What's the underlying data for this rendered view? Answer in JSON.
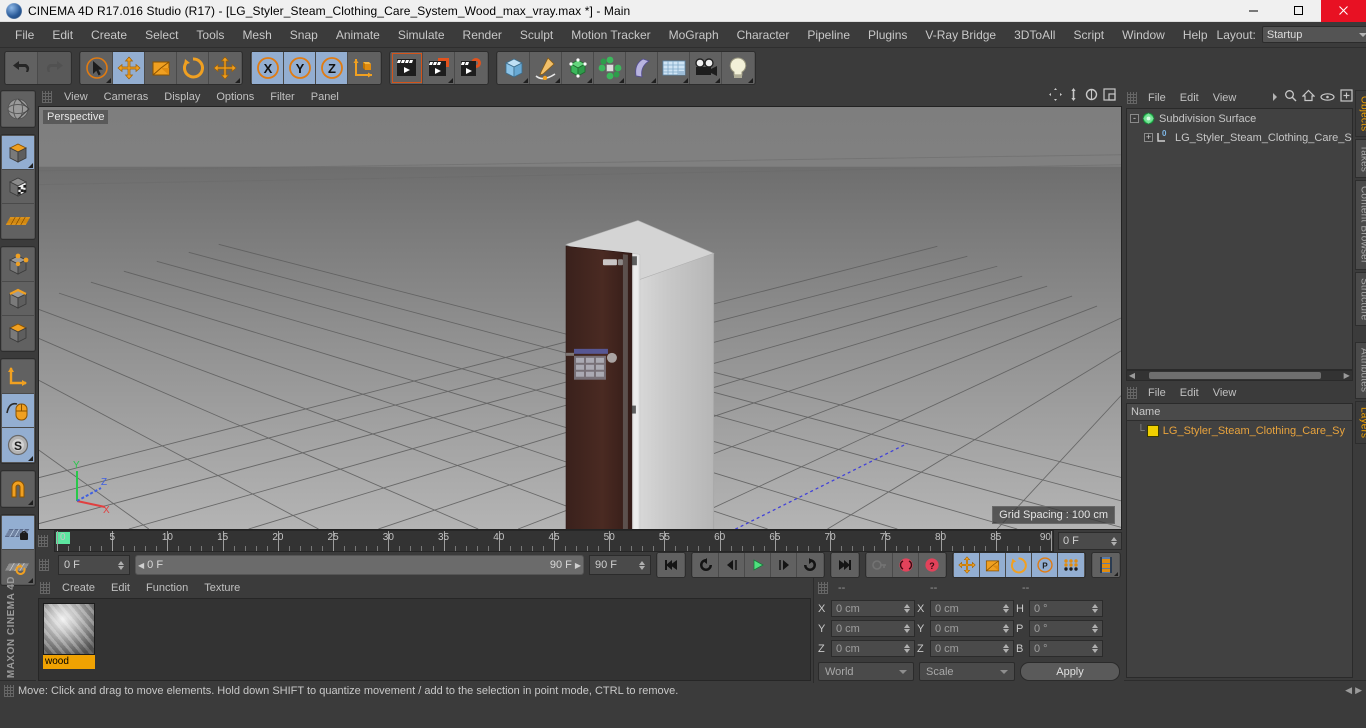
{
  "titlebar": {
    "title": "CINEMA 4D R17.016 Studio (R17) - [LG_Styler_Steam_Clothing_Care_System_Wood_max_vray.max *] - Main",
    "minimize": "minimize-icon",
    "maximize": "maximize-icon",
    "close": "close-icon"
  },
  "menubar": {
    "items": [
      "File",
      "Edit",
      "Create",
      "Select",
      "Tools",
      "Mesh",
      "Snap",
      "Animate",
      "Simulate",
      "Render",
      "Sculpt",
      "Motion Tracker",
      "MoGraph",
      "Character",
      "Pipeline",
      "Plugins",
      "V-Ray Bridge",
      "3DToAll",
      "Script",
      "Window",
      "Help"
    ],
    "layout_label": "Layout:",
    "layout_value": "Startup",
    "search_icon": "search-icon"
  },
  "toolbar": {
    "groups": [
      {
        "name": "history",
        "buttons": [
          {
            "name": "undo-button",
            "icon": "undo-arrow-icon",
            "state": "normal"
          },
          {
            "name": "redo-button",
            "icon": "redo-arrow-icon",
            "state": "disabled"
          }
        ]
      },
      {
        "name": "transform-tools",
        "buttons": [
          {
            "name": "live-selection-tool",
            "icon": "cursor-circle-icon",
            "state": "corner"
          },
          {
            "name": "move-tool",
            "icon": "move-arrows-icon",
            "state": "active"
          },
          {
            "name": "scale-tool",
            "icon": "scale-box-icon",
            "state": "normal"
          },
          {
            "name": "rotate-tool",
            "icon": "rotate-circle-icon",
            "state": "normal"
          },
          {
            "name": "move-duplicate-tool",
            "icon": "move-arrows-icon",
            "state": "corner"
          }
        ]
      },
      {
        "name": "axis-locks",
        "buttons": [
          {
            "name": "lock-x-axis",
            "icon": "x-axis-icon",
            "state": "active"
          },
          {
            "name": "lock-y-axis",
            "icon": "y-axis-icon",
            "state": "active"
          },
          {
            "name": "lock-z-axis",
            "icon": "z-axis-icon",
            "state": "active"
          },
          {
            "name": "world-object-axis",
            "icon": "axis-cube-icon",
            "state": "normal"
          }
        ]
      },
      {
        "name": "render-group",
        "buttons": [
          {
            "name": "render-view-button",
            "icon": "clapper-icon",
            "state": "highlight"
          },
          {
            "name": "render-to-picture-viewer",
            "icon": "clapper-render-icon",
            "state": "corner"
          },
          {
            "name": "render-settings-button",
            "icon": "clapper-gear-icon",
            "state": "normal"
          }
        ]
      },
      {
        "name": "create-group",
        "buttons": [
          {
            "name": "add-cube-button",
            "icon": "cube-icon",
            "state": "corner"
          },
          {
            "name": "add-spline-button",
            "icon": "pen-spline-icon",
            "state": "corner"
          },
          {
            "name": "add-nurbs-button",
            "icon": "green-cube-icon",
            "state": "corner"
          },
          {
            "name": "add-array-button",
            "icon": "green-array-icon",
            "state": "corner"
          },
          {
            "name": "add-bend-button",
            "icon": "bend-deformer-icon",
            "state": "corner"
          },
          {
            "name": "add-floor-button",
            "icon": "floor-grid-icon",
            "state": "corner"
          },
          {
            "name": "add-camera-button",
            "icon": "camera-icon",
            "state": "corner"
          },
          {
            "name": "add-light-button",
            "icon": "light-bulb-icon",
            "state": "corner"
          }
        ]
      }
    ]
  },
  "lefttoolbar": {
    "groups": [
      {
        "buttons": [
          {
            "name": "make-editable-button",
            "icon": "globe-editable-icon",
            "state": "normal"
          }
        ]
      },
      {
        "buttons": [
          {
            "name": "model-mode-button",
            "icon": "model-cube-icon",
            "state": "active"
          },
          {
            "name": "texture-mode-button",
            "icon": "texture-checker-cube-icon",
            "state": "normal"
          },
          {
            "name": "uv-mode-button",
            "icon": "uv-mesh-icon",
            "state": "normal"
          }
        ]
      },
      {
        "buttons": [
          {
            "name": "points-mode-button",
            "icon": "points-cube-icon",
            "state": "normal"
          },
          {
            "name": "edges-mode-button",
            "icon": "edges-cube-icon",
            "state": "normal"
          },
          {
            "name": "polygons-mode-button",
            "icon": "polygons-cube-icon",
            "state": "normal"
          }
        ]
      },
      {
        "buttons": [
          {
            "name": "object-axis-mode-button",
            "icon": "axis-corner-icon",
            "state": "normal"
          },
          {
            "name": "viewport-solo-button",
            "icon": "mouse-curve-icon",
            "state": "active"
          },
          {
            "name": "soft-selection-button",
            "icon": "s-circle-icon",
            "state": "active"
          }
        ]
      },
      {
        "buttons": [
          {
            "name": "snap-button",
            "icon": "magnet-icon",
            "state": "corner"
          }
        ]
      },
      {
        "buttons": [
          {
            "name": "workplane-lock-button",
            "icon": "grid-lock-icon",
            "state": "active"
          },
          {
            "name": "workplane-rotate-button",
            "icon": "grid-rotate-icon",
            "state": "corner"
          }
        ]
      }
    ],
    "brand": "MAXON CINEMA 4D"
  },
  "viewport": {
    "menus": [
      "View",
      "Cameras",
      "Display",
      "Options",
      "Filter",
      "Panel"
    ],
    "nav_icons": [
      "pan-icon",
      "zoom-icon",
      "rotate-icon",
      "maximize-viewport-icon"
    ],
    "label": "Perspective",
    "grid_spacing": "Grid Spacing : 100 cm",
    "axis_gizmo": {
      "x": "X",
      "y": "Y",
      "z": "Z"
    }
  },
  "timeline": {
    "start": 0,
    "end": 90,
    "major_ticks": [
      0,
      5,
      10,
      15,
      20,
      25,
      30,
      35,
      40,
      45,
      50,
      55,
      60,
      65,
      70,
      75,
      80,
      85,
      90
    ],
    "current_frame": "0 F",
    "playhead_frame": 0
  },
  "playbar": {
    "current_frame_field": "0 F",
    "range_start": "0 F",
    "range_end": "90 F",
    "end_frame_field": "90 F",
    "buttons": [
      {
        "name": "go-to-start-button",
        "icon": "skip-start-icon",
        "state": "normal"
      },
      {
        "name": "previous-key-button",
        "icon": "previous-key-icon",
        "state": "normal"
      },
      {
        "name": "step-back-button",
        "icon": "step-back-icon",
        "state": "normal"
      },
      {
        "name": "play-button",
        "icon": "play-icon",
        "state": "normal"
      },
      {
        "name": "step-forward-button",
        "icon": "step-forward-icon",
        "state": "normal"
      },
      {
        "name": "next-key-button",
        "icon": "next-key-icon",
        "state": "normal"
      },
      {
        "name": "go-to-end-button",
        "icon": "skip-end-icon",
        "state": "normal"
      },
      {
        "name": "record-active-objects-button",
        "icon": "key-disabled-icon",
        "state": "disabled"
      },
      {
        "name": "autokeying-button",
        "icon": "autokey-icon",
        "state": "normal"
      },
      {
        "name": "keyframe-selection-button",
        "icon": "question-key-icon",
        "state": "normal"
      },
      {
        "name": "position-key-button",
        "icon": "move-arrows-icon",
        "state": "active"
      },
      {
        "name": "scale-key-button",
        "icon": "scale-box-icon",
        "state": "active"
      },
      {
        "name": "rotation-key-button",
        "icon": "rotate-circle-icon",
        "state": "active"
      },
      {
        "name": "pla-key-button",
        "icon": "p-circle-icon",
        "state": "active"
      },
      {
        "name": "point-level-animation-button",
        "icon": "dots-grid-icon",
        "state": "active"
      },
      {
        "name": "timeline-filmstrip-button",
        "icon": "filmstrip-icon",
        "state": "normal"
      }
    ]
  },
  "materials": {
    "menus": [
      "Create",
      "Edit",
      "Function",
      "Texture"
    ],
    "items": [
      {
        "name": "wood",
        "label": "wood"
      }
    ]
  },
  "coordinates": {
    "header_dashes": [
      "--",
      "--",
      "--"
    ],
    "rows": [
      {
        "axis1": "X",
        "val1": "0 cm",
        "axis2": "X",
        "val2": "0 cm",
        "axis3": "H",
        "val3": "0 °"
      },
      {
        "axis1": "Y",
        "val1": "0 cm",
        "axis2": "Y",
        "val2": "0 cm",
        "axis3": "P",
        "val3": "0 °"
      },
      {
        "axis1": "Z",
        "val1": "0 cm",
        "axis2": "Z",
        "val2": "0 cm",
        "axis3": "B",
        "val3": "0 °"
      }
    ],
    "coord_system": "World",
    "mode": "Scale",
    "apply_label": "Apply"
  },
  "object_manager": {
    "menus": [
      "File",
      "Edit",
      "View"
    ],
    "overflow_icon": "chevron-right-icon",
    "icons": [
      "search-icon",
      "home-icon",
      "eye-icon",
      "new-layer-icon"
    ],
    "rows": [
      {
        "name": "Subdivision Surface",
        "indent": 0,
        "icon": "subdivision-surface-icon",
        "expander": "-"
      },
      {
        "name": "LG_Styler_Steam_Clothing_Care_S",
        "indent": 1,
        "icon": "null-object-icon",
        "expander": "+",
        "badge": "0"
      }
    ]
  },
  "layer_manager": {
    "menus": [
      "File",
      "Edit",
      "View"
    ],
    "column_header": "Name",
    "rows": [
      {
        "name": "LG_Styler_Steam_Clothing_Care_Sy",
        "color": "#f0d000"
      }
    ]
  },
  "right_tabs": {
    "top": [
      "Objects",
      "Takes",
      "Content Browser",
      "Structure"
    ],
    "bottom": [
      "Attributes",
      "Layers"
    ],
    "active_top": "Objects",
    "active_bottom": "Layers"
  },
  "statusbar": {
    "text": "Move: Click and drag to move elements. Hold down SHIFT to quantize movement / add to the selection in point mode, CTRL to remove."
  },
  "colors": {
    "accent_orange": "#f0a202",
    "active_blue": "#93aed1",
    "panel_bg": "#3b3b3b",
    "field_bg": "#4a4a4a",
    "close_red": "#e81123",
    "playhead_green": "#5de6a0"
  }
}
